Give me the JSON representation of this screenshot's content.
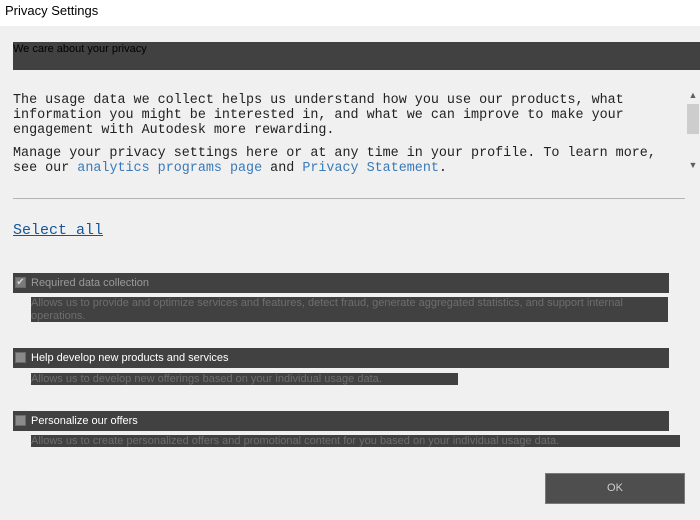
{
  "window": {
    "title": "Privacy Settings"
  },
  "header": {
    "text": "We care about your privacy"
  },
  "body": {
    "para1": "The usage data we collect helps us understand how you use our products, what information you might be interested in, and what we can improve to make your engagement with Autodesk more rewarding.",
    "para2_prefix": "Manage your privacy settings here or at any time in your profile. To learn more, see our ",
    "para2_link1": "analytics programs page",
    "para2_mid": " and ",
    "para2_link2": "Privacy Statement",
    "para2_suffix": "."
  },
  "select_all": "Select all",
  "options": [
    {
      "label": "Required data collection",
      "description": "Allows us to provide and optimize services and features, detect fraud, generate aggregated statistics, and support internal operations.",
      "checked": true,
      "disabled": true
    },
    {
      "label": "Help develop new products and services",
      "description": "Allows us to develop new offerings based on your individual usage data.",
      "checked": false,
      "disabled": false
    },
    {
      "label": "Personalize our offers",
      "description": "Allows us to create personalized offers and promotional content for you based on your individual usage data.",
      "checked": false,
      "disabled": false
    }
  ],
  "buttons": {
    "ok": "OK"
  },
  "icons": {
    "checkmark": "checkmark-icon",
    "scroll_up": "arrow-up-icon",
    "scroll_down": "arrow-down-icon"
  }
}
